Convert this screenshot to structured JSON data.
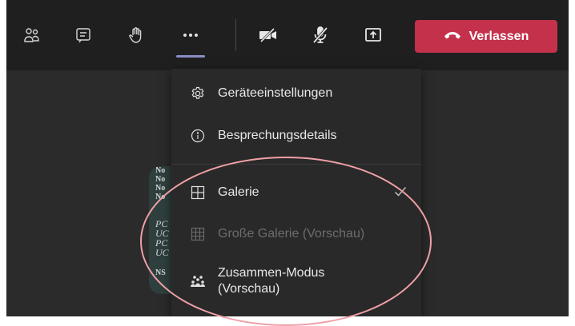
{
  "toolbar": {
    "buttons": [
      {
        "name": "participants-icon"
      },
      {
        "name": "chat-icon"
      },
      {
        "name": "raise-hand-icon"
      },
      {
        "name": "more-actions-icon"
      },
      {
        "name": "camera-off-icon"
      },
      {
        "name": "mic-off-icon"
      },
      {
        "name": "share-screen-icon"
      }
    ],
    "leave_label": "Verlassen",
    "leave_icon": "phone-hangup-icon",
    "leave_color": "#c4314b",
    "active_indicator_color": "#8b8cc7"
  },
  "participant": {
    "lines": [
      "No",
      "No",
      "No",
      "No",
      "",
      "PC",
      "UC",
      "PC",
      "UC",
      "",
      "NS"
    ]
  },
  "menu": {
    "items": [
      {
        "label": "Geräteeinstellungen",
        "icon": "gear-icon"
      },
      {
        "label": "Besprechungsdetails",
        "icon": "info-icon"
      },
      {
        "label": "Galerie",
        "icon": "gallery-grid-icon",
        "checked": true
      },
      {
        "label": "Große Galerie (Vorschau)",
        "icon": "large-gallery-icon",
        "disabled": true
      },
      {
        "label_line1": "Zusammen-Modus",
        "label_line2": "(Vorschau)",
        "icon": "together-mode-icon"
      }
    ]
  },
  "annotation": {
    "color": "#f0a0a7"
  }
}
